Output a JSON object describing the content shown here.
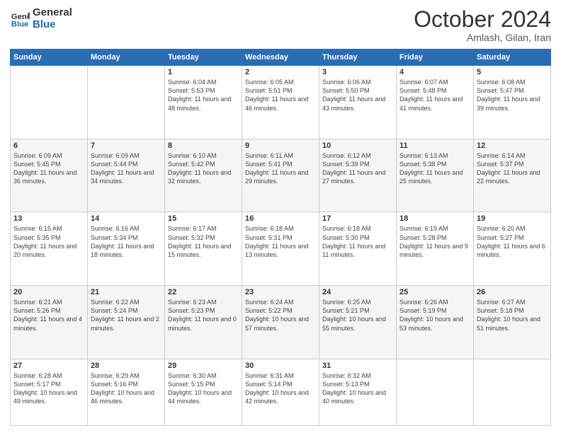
{
  "logo": {
    "line1": "General",
    "line2": "Blue"
  },
  "header": {
    "month": "October 2024",
    "location": "Amlash, Gilan, Iran"
  },
  "weekdays": [
    "Sunday",
    "Monday",
    "Tuesday",
    "Wednesday",
    "Thursday",
    "Friday",
    "Saturday"
  ],
  "weeks": [
    [
      {
        "day": "",
        "info": ""
      },
      {
        "day": "",
        "info": ""
      },
      {
        "day": "1",
        "info": "Sunrise: 6:04 AM\nSunset: 5:53 PM\nDaylight: 11 hours and 48 minutes."
      },
      {
        "day": "2",
        "info": "Sunrise: 6:05 AM\nSunset: 5:51 PM\nDaylight: 11 hours and 46 minutes."
      },
      {
        "day": "3",
        "info": "Sunrise: 6:06 AM\nSunset: 5:50 PM\nDaylight: 11 hours and 43 minutes."
      },
      {
        "day": "4",
        "info": "Sunrise: 6:07 AM\nSunset: 5:48 PM\nDaylight: 11 hours and 41 minutes."
      },
      {
        "day": "5",
        "info": "Sunrise: 6:08 AM\nSunset: 5:47 PM\nDaylight: 11 hours and 39 minutes."
      }
    ],
    [
      {
        "day": "6",
        "info": "Sunrise: 6:09 AM\nSunset: 5:45 PM\nDaylight: 11 hours and 36 minutes."
      },
      {
        "day": "7",
        "info": "Sunrise: 6:09 AM\nSunset: 5:44 PM\nDaylight: 11 hours and 34 minutes."
      },
      {
        "day": "8",
        "info": "Sunrise: 6:10 AM\nSunset: 5:42 PM\nDaylight: 11 hours and 32 minutes."
      },
      {
        "day": "9",
        "info": "Sunrise: 6:11 AM\nSunset: 5:41 PM\nDaylight: 11 hours and 29 minutes."
      },
      {
        "day": "10",
        "info": "Sunrise: 6:12 AM\nSunset: 5:39 PM\nDaylight: 11 hours and 27 minutes."
      },
      {
        "day": "11",
        "info": "Sunrise: 6:13 AM\nSunset: 5:38 PM\nDaylight: 11 hours and 25 minutes."
      },
      {
        "day": "12",
        "info": "Sunrise: 6:14 AM\nSunset: 5:37 PM\nDaylight: 11 hours and 22 minutes."
      }
    ],
    [
      {
        "day": "13",
        "info": "Sunrise: 6:15 AM\nSunset: 5:35 PM\nDaylight: 11 hours and 20 minutes."
      },
      {
        "day": "14",
        "info": "Sunrise: 6:16 AM\nSunset: 5:34 PM\nDaylight: 11 hours and 18 minutes."
      },
      {
        "day": "15",
        "info": "Sunrise: 6:17 AM\nSunset: 5:32 PM\nDaylight: 11 hours and 15 minutes."
      },
      {
        "day": "16",
        "info": "Sunrise: 6:18 AM\nSunset: 5:31 PM\nDaylight: 11 hours and 13 minutes."
      },
      {
        "day": "17",
        "info": "Sunrise: 6:18 AM\nSunset: 5:30 PM\nDaylight: 11 hours and 11 minutes."
      },
      {
        "day": "18",
        "info": "Sunrise: 6:19 AM\nSunset: 5:28 PM\nDaylight: 11 hours and 9 minutes."
      },
      {
        "day": "19",
        "info": "Sunrise: 6:20 AM\nSunset: 5:27 PM\nDaylight: 11 hours and 6 minutes."
      }
    ],
    [
      {
        "day": "20",
        "info": "Sunrise: 6:21 AM\nSunset: 5:26 PM\nDaylight: 11 hours and 4 minutes."
      },
      {
        "day": "21",
        "info": "Sunrise: 6:22 AM\nSunset: 5:24 PM\nDaylight: 11 hours and 2 minutes."
      },
      {
        "day": "22",
        "info": "Sunrise: 6:23 AM\nSunset: 5:23 PM\nDaylight: 11 hours and 0 minutes."
      },
      {
        "day": "23",
        "info": "Sunrise: 6:24 AM\nSunset: 5:22 PM\nDaylight: 10 hours and 57 minutes."
      },
      {
        "day": "24",
        "info": "Sunrise: 6:25 AM\nSunset: 5:21 PM\nDaylight: 10 hours and 55 minutes."
      },
      {
        "day": "25",
        "info": "Sunrise: 6:26 AM\nSunset: 5:19 PM\nDaylight: 10 hours and 53 minutes."
      },
      {
        "day": "26",
        "info": "Sunrise: 6:27 AM\nSunset: 5:18 PM\nDaylight: 10 hours and 51 minutes."
      }
    ],
    [
      {
        "day": "27",
        "info": "Sunrise: 6:28 AM\nSunset: 5:17 PM\nDaylight: 10 hours and 49 minutes."
      },
      {
        "day": "28",
        "info": "Sunrise: 6:29 AM\nSunset: 5:16 PM\nDaylight: 10 hours and 46 minutes."
      },
      {
        "day": "29",
        "info": "Sunrise: 6:30 AM\nSunset: 5:15 PM\nDaylight: 10 hours and 44 minutes."
      },
      {
        "day": "30",
        "info": "Sunrise: 6:31 AM\nSunset: 5:14 PM\nDaylight: 10 hours and 42 minutes."
      },
      {
        "day": "31",
        "info": "Sunrise: 6:32 AM\nSunset: 5:13 PM\nDaylight: 10 hours and 40 minutes."
      },
      {
        "day": "",
        "info": ""
      },
      {
        "day": "",
        "info": ""
      }
    ]
  ]
}
